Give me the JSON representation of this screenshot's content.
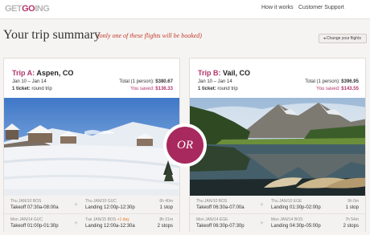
{
  "header": {
    "logo": {
      "part1": "GET",
      "part2": "GO",
      "part3": "ING"
    },
    "nav": [
      "How it works",
      "Customer Support"
    ]
  },
  "summary": {
    "title": "Your trip summary",
    "subtitle": "(only one of these flights will be booked)",
    "change_button": "◂ Change your flights"
  },
  "or_label": "OR",
  "trips": [
    {
      "label": "Trip A:",
      "destination": "Aspen, CO",
      "dates": "Jan 10 – Jan 14",
      "total_label": "Total (1 person):",
      "total": "$380.67",
      "ticket_label": "1 ticket:",
      "ticket_type": "round trip",
      "saved_label": "You saved:",
      "saved": "$136.33",
      "legs": [
        {
          "dep_date": "Thu JAN/10 BOS",
          "dep_time": "Takeoff 07:30a-08:00a",
          "arr_date": "Thu JAN/10 GUC",
          "arr_plus": "",
          "arr_time": "Landing 12:00p-12:30p",
          "duration": "6h 40m",
          "stops": "1 stop"
        },
        {
          "dep_date": "Mon JAN/14 GUC",
          "dep_time": "Takeoff 01:00p-01:30p",
          "arr_date": "Tue JAN/15 BOS",
          "arr_plus": "+1 day",
          "arr_time": "Landing 12:00a-12:30a",
          "duration": "8h 21m",
          "stops": "2 stops"
        }
      ]
    },
    {
      "label": "Trip B:",
      "destination": "Vail, CO",
      "dates": "Jan 10 – Jan 14",
      "total_label": "Total (1 person):",
      "total": "$396.95",
      "ticket_label": "1 ticket:",
      "ticket_type": "round trip",
      "saved_label": "You saved:",
      "saved": "$143.55",
      "legs": [
        {
          "dep_date": "Thu JAN/10 BOS",
          "dep_time": "Takeoff 06:30a-07:00a",
          "arr_date": "Thu JAN/10 EGE",
          "arr_plus": "",
          "arr_time": "Landing 01:30p-02:00p",
          "duration": "9h 0m",
          "stops": "1 stop"
        },
        {
          "dep_date": "Mon JAN/14 EGE",
          "dep_time": "Takeoff 06:30p-07:30p",
          "arr_date": "Mon JAN/14 BOS",
          "arr_plus": "",
          "arr_time": "Landing 04:30p-05:00p",
          "duration": "7h 54m",
          "stops": "2 stops"
        }
      ]
    }
  ],
  "colors": {
    "brand": "#b3346b",
    "saved": "#b3346b",
    "background": "#f6f4f2"
  }
}
